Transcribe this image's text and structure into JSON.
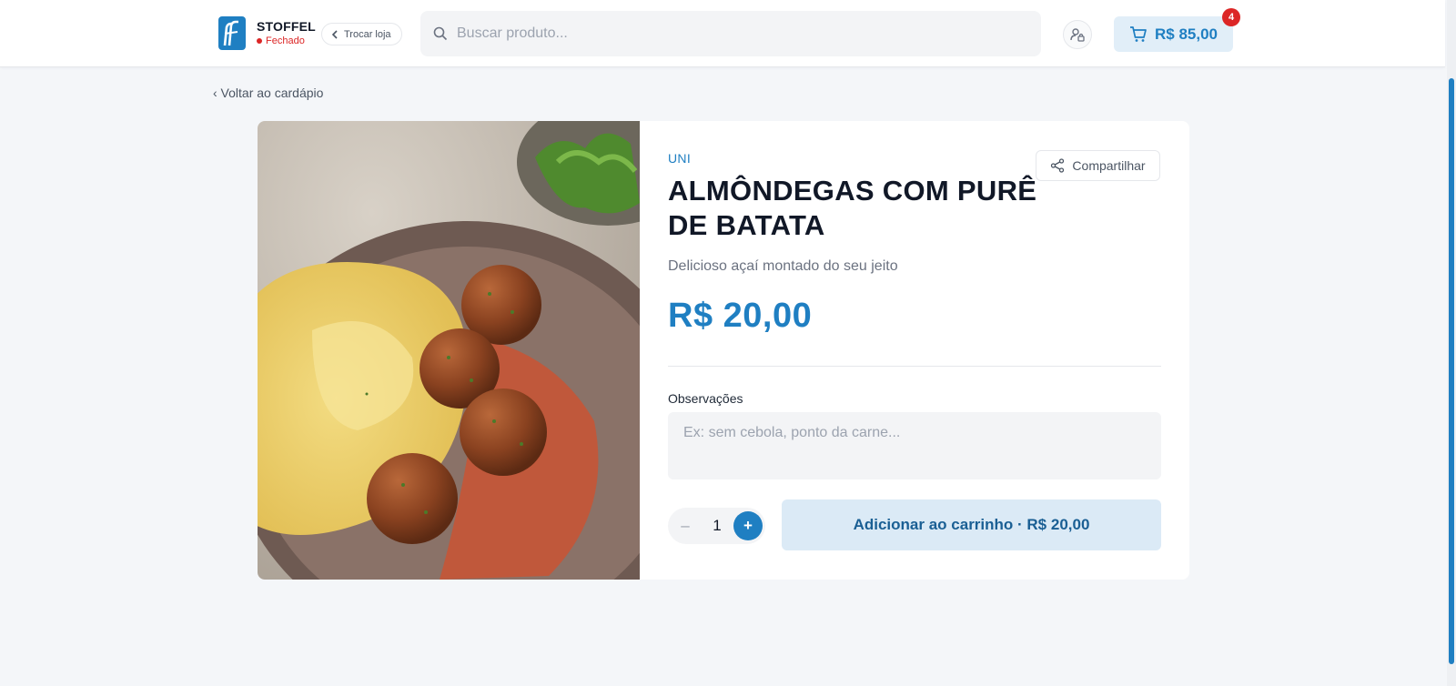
{
  "header": {
    "store_name": "STOFFEL",
    "store_status": "Fechado",
    "switch_store_label": "Trocar loja",
    "search_placeholder": "Buscar produto...",
    "cart_total": "R$ 85,00",
    "cart_count": "4"
  },
  "nav": {
    "back_label": "‹ Voltar ao cardápio"
  },
  "product": {
    "unit": "UNI",
    "share_label": "Compartilhar",
    "title": "ALMÔNDEGAS COM PURÊ DE BATATA",
    "description": "Delicioso açaí montado do seu jeito",
    "price": "R$ 20,00",
    "notes_label": "Observações",
    "notes_placeholder": "Ex: sem cebola, ponto da carne...",
    "notes_value": "",
    "quantity": "1",
    "quantity_minus": "–",
    "quantity_plus": "+",
    "add_to_cart_label": "Adicionar ao carrinho · R$ 20,00"
  },
  "icons": {
    "logo": "brand-logo-icon",
    "back": "chevron-left-icon",
    "search": "search-icon",
    "user": "user-lock-icon",
    "cart": "shopping-cart-icon",
    "share": "share-icon"
  },
  "colors": {
    "brand": "#1f7fc2",
    "closed": "#dc2626",
    "page_bg": "#f4f6f9"
  }
}
